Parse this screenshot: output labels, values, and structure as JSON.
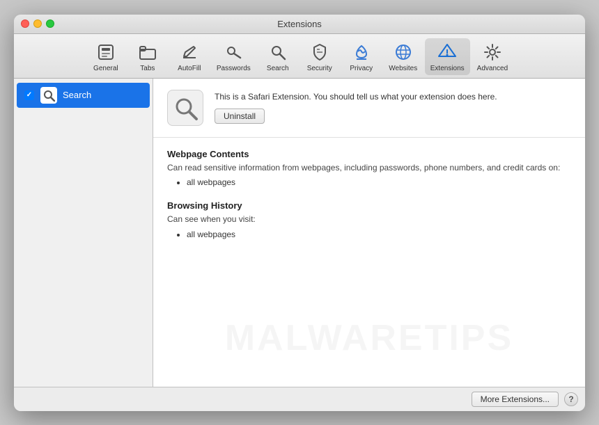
{
  "window": {
    "title": "Extensions"
  },
  "titlebar": {
    "title": "Extensions",
    "buttons": {
      "close": "close",
      "minimize": "minimize",
      "maximize": "maximize"
    }
  },
  "toolbar": {
    "items": [
      {
        "id": "general",
        "label": "General",
        "icon": "general-icon"
      },
      {
        "id": "tabs",
        "label": "Tabs",
        "icon": "tabs-icon"
      },
      {
        "id": "autofill",
        "label": "AutoFill",
        "icon": "autofill-icon"
      },
      {
        "id": "passwords",
        "label": "Passwords",
        "icon": "passwords-icon"
      },
      {
        "id": "search",
        "label": "Search",
        "icon": "search-icon"
      },
      {
        "id": "security",
        "label": "Security",
        "icon": "security-icon"
      },
      {
        "id": "privacy",
        "label": "Privacy",
        "icon": "privacy-icon"
      },
      {
        "id": "websites",
        "label": "Websites",
        "icon": "websites-icon"
      },
      {
        "id": "extensions",
        "label": "Extensions",
        "icon": "extensions-icon"
      },
      {
        "id": "advanced",
        "label": "Advanced",
        "icon": "advanced-icon"
      }
    ],
    "active_item": "extensions"
  },
  "sidebar": {
    "items": [
      {
        "id": "search-ext",
        "label": "Search",
        "enabled": true,
        "selected": true
      }
    ]
  },
  "detail": {
    "extension": {
      "name": "Search",
      "description": "This is a Safari Extension. You should tell us what your extension does here.",
      "uninstall_label": "Uninstall"
    },
    "permissions": [
      {
        "title": "Webpage Contents",
        "description": "Can read sensitive information from webpages, including passwords, phone numbers, and credit cards on:",
        "items": [
          "all webpages"
        ]
      },
      {
        "title": "Browsing History",
        "description": "Can see when you visit:",
        "items": [
          "all webpages"
        ]
      }
    ]
  },
  "bottom_bar": {
    "more_extensions_label": "More Extensions...",
    "help_label": "?"
  },
  "watermark": {
    "text": "MALWARETIPS"
  }
}
